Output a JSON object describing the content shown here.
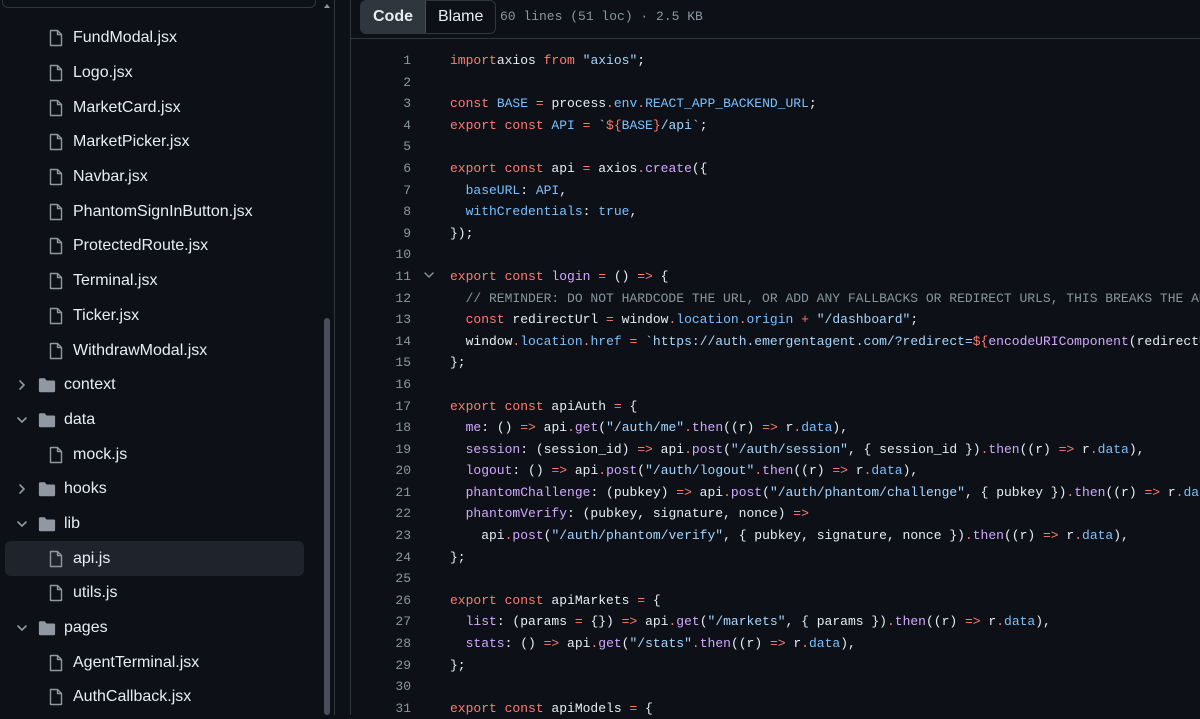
{
  "sidebar": {
    "tree": [
      {
        "type": "file",
        "label": "FundModal.jsx"
      },
      {
        "type": "file",
        "label": "Logo.jsx"
      },
      {
        "type": "file",
        "label": "MarketCard.jsx"
      },
      {
        "type": "file",
        "label": "MarketPicker.jsx"
      },
      {
        "type": "file",
        "label": "Navbar.jsx"
      },
      {
        "type": "file",
        "label": "PhantomSignInButton.jsx"
      },
      {
        "type": "file",
        "label": "ProtectedRoute.jsx"
      },
      {
        "type": "file",
        "label": "Terminal.jsx"
      },
      {
        "type": "file",
        "label": "Ticker.jsx"
      },
      {
        "type": "file",
        "label": "WithdrawModal.jsx"
      },
      {
        "type": "folder",
        "label": "context",
        "expanded": false
      },
      {
        "type": "folder",
        "label": "data",
        "expanded": true
      },
      {
        "type": "file",
        "label": "mock.js"
      },
      {
        "type": "folder",
        "label": "hooks",
        "expanded": false
      },
      {
        "type": "folder",
        "label": "lib",
        "expanded": true
      },
      {
        "type": "file",
        "label": "api.js",
        "selected": true
      },
      {
        "type": "file",
        "label": "utils.js"
      },
      {
        "type": "folder",
        "label": "pages",
        "expanded": true
      },
      {
        "type": "file",
        "label": "AgentTerminal.jsx"
      },
      {
        "type": "file",
        "label": "AuthCallback.jsx"
      }
    ]
  },
  "toolbar": {
    "code_label": "Code",
    "blame_label": "Blame",
    "file_info": "60 lines (51 loc) · 2.5 KB"
  },
  "code": {
    "lines": [
      {
        "n": "1",
        "fold": false,
        "tokens": [
          [
            "kw",
            "import"
          ],
          [
            "",
            "axios"
          ],
          [
            "kw",
            " from "
          ],
          [
            "str",
            "\"axios\""
          ],
          [
            "",
            ";"
          ]
        ]
      },
      {
        "n": "2",
        "fold": false,
        "tokens": []
      },
      {
        "n": "3",
        "fold": false,
        "tokens": [
          [
            "kw",
            "const "
          ],
          [
            "prop",
            "BASE"
          ],
          [
            "kw",
            " = "
          ],
          [
            "",
            "process"
          ],
          [
            "kw",
            "."
          ],
          [
            "prop",
            "env"
          ],
          [
            "kw",
            "."
          ],
          [
            "prop",
            "REACT_APP_BACKEND_URL"
          ],
          [
            "",
            ";"
          ]
        ]
      },
      {
        "n": "4",
        "fold": false,
        "tokens": [
          [
            "kw",
            "export const "
          ],
          [
            "prop",
            "API"
          ],
          [
            "kw",
            " = "
          ],
          [
            "str",
            "`"
          ],
          [
            "kw",
            "${"
          ],
          [
            "prop",
            "BASE"
          ],
          [
            "kw",
            "}"
          ],
          [
            "str",
            "/api`"
          ],
          [
            "",
            ";"
          ]
        ]
      },
      {
        "n": "5",
        "fold": false,
        "tokens": []
      },
      {
        "n": "6",
        "fold": false,
        "tokens": [
          [
            "kw",
            "export const "
          ],
          [
            "",
            "api"
          ],
          [
            "kw",
            " = "
          ],
          [
            "",
            "axios"
          ],
          [
            "kw",
            "."
          ],
          [
            "fn",
            "create"
          ],
          [
            "",
            "({"
          ]
        ]
      },
      {
        "n": "7",
        "fold": false,
        "tokens": [
          [
            "prop",
            "  baseURL"
          ],
          [
            "",
            ": "
          ],
          [
            "prop",
            "API"
          ],
          [
            "",
            ","
          ]
        ]
      },
      {
        "n": "8",
        "fold": false,
        "tokens": [
          [
            "prop",
            "  withCredentials"
          ],
          [
            "",
            ": "
          ],
          [
            "prop",
            "true"
          ],
          [
            "",
            ","
          ]
        ]
      },
      {
        "n": "9",
        "fold": false,
        "tokens": [
          [
            "",
            "});"
          ]
        ]
      },
      {
        "n": "10",
        "fold": false,
        "tokens": []
      },
      {
        "n": "11",
        "fold": true,
        "tokens": [
          [
            "kw",
            "export const "
          ],
          [
            "fn",
            "login"
          ],
          [
            "kw",
            " = "
          ],
          [
            "",
            "() "
          ],
          [
            "kw",
            "=>"
          ],
          [
            "",
            " {"
          ]
        ]
      },
      {
        "n": "12",
        "fold": false,
        "tokens": [
          [
            "cmt",
            "  // REMINDER: DO NOT HARDCODE THE URL, OR ADD ANY FALLBACKS OR REDIRECT URLS, THIS BREAKS THE AUTH"
          ]
        ]
      },
      {
        "n": "13",
        "fold": false,
        "tokens": [
          [
            "kw",
            "  const "
          ],
          [
            "",
            "redirectUrl"
          ],
          [
            "kw",
            " = "
          ],
          [
            "",
            "window"
          ],
          [
            "kw",
            "."
          ],
          [
            "prop",
            "location"
          ],
          [
            "kw",
            "."
          ],
          [
            "prop",
            "origin"
          ],
          [
            "kw",
            " + "
          ],
          [
            "str",
            "\"/dashboard\""
          ],
          [
            "",
            ";"
          ]
        ]
      },
      {
        "n": "14",
        "fold": false,
        "tokens": [
          [
            "",
            "  window"
          ],
          [
            "kw",
            "."
          ],
          [
            "prop",
            "location"
          ],
          [
            "kw",
            "."
          ],
          [
            "prop",
            "href"
          ],
          [
            "kw",
            " = "
          ],
          [
            "str",
            "`https://auth.emergentagent.com/?redirect="
          ],
          [
            "kw",
            "${"
          ],
          [
            "fn",
            "encodeURIComponent"
          ],
          [
            "",
            "(redirectUrl)"
          ],
          [
            "kw",
            "}"
          ],
          [
            "str",
            "`"
          ],
          [
            "",
            ";"
          ]
        ]
      },
      {
        "n": "15",
        "fold": false,
        "tokens": [
          [
            "",
            "};"
          ]
        ]
      },
      {
        "n": "16",
        "fold": false,
        "tokens": []
      },
      {
        "n": "17",
        "fold": false,
        "tokens": [
          [
            "kw",
            "export const "
          ],
          [
            "",
            "apiAuth"
          ],
          [
            "kw",
            " = "
          ],
          [
            "",
            "{"
          ]
        ]
      },
      {
        "n": "18",
        "fold": false,
        "tokens": [
          [
            "fn",
            "  me"
          ],
          [
            "",
            ": () "
          ],
          [
            "kw",
            "=>"
          ],
          [
            "",
            " api"
          ],
          [
            "kw",
            "."
          ],
          [
            "fn",
            "get"
          ],
          [
            "",
            "("
          ],
          [
            "str",
            "\"/auth/me\""
          ],
          [
            ")"
          ],
          [
            "kw",
            "."
          ],
          [
            "fn",
            "then"
          ],
          [
            "",
            "((r) "
          ],
          [
            "kw",
            "=>"
          ],
          [
            "",
            " r"
          ],
          [
            "kw",
            "."
          ],
          [
            "prop",
            "data"
          ],
          [
            "",
            "),"
          ]
        ]
      },
      {
        "n": "19",
        "fold": false,
        "tokens": [
          [
            "fn",
            "  session"
          ],
          [
            "",
            ": (session_id) "
          ],
          [
            "kw",
            "=>"
          ],
          [
            "",
            " api"
          ],
          [
            "kw",
            "."
          ],
          [
            "fn",
            "post"
          ],
          [
            "",
            "("
          ],
          [
            "str",
            "\"/auth/session\""
          ],
          [
            "",
            ", { session_id })"
          ],
          [
            "kw",
            "."
          ],
          [
            "fn",
            "then"
          ],
          [
            "",
            "((r) "
          ],
          [
            "kw",
            "=>"
          ],
          [
            "",
            " r"
          ],
          [
            "kw",
            "."
          ],
          [
            "prop",
            "data"
          ],
          [
            "",
            "),"
          ]
        ]
      },
      {
        "n": "20",
        "fold": false,
        "tokens": [
          [
            "fn",
            "  logout"
          ],
          [
            "",
            ": () "
          ],
          [
            "kw",
            "=>"
          ],
          [
            "",
            " api"
          ],
          [
            "kw",
            "."
          ],
          [
            "fn",
            "post"
          ],
          [
            "",
            "("
          ],
          [
            "str",
            "\"/auth/logout\""
          ],
          [
            ")"
          ],
          [
            "kw",
            "."
          ],
          [
            "fn",
            "then"
          ],
          [
            "",
            "((r) "
          ],
          [
            "kw",
            "=>"
          ],
          [
            "",
            " r"
          ],
          [
            "kw",
            "."
          ],
          [
            "prop",
            "data"
          ],
          [
            "",
            "),"
          ]
        ]
      },
      {
        "n": "21",
        "fold": false,
        "tokens": [
          [
            "fn",
            "  phantomChallenge"
          ],
          [
            "",
            ": (pubkey) "
          ],
          [
            "kw",
            "=>"
          ],
          [
            "",
            " api"
          ],
          [
            "kw",
            "."
          ],
          [
            "fn",
            "post"
          ],
          [
            "",
            "("
          ],
          [
            "str",
            "\"/auth/phantom/challenge\""
          ],
          [
            "",
            ", { pubkey })"
          ],
          [
            "kw",
            "."
          ],
          [
            "fn",
            "then"
          ],
          [
            "",
            "((r) "
          ],
          [
            "kw",
            "=>"
          ],
          [
            "",
            " r"
          ],
          [
            "kw",
            "."
          ],
          [
            "prop",
            "data"
          ],
          [
            "",
            "),"
          ]
        ]
      },
      {
        "n": "22",
        "fold": false,
        "tokens": [
          [
            "fn",
            "  phantomVerify"
          ],
          [
            "",
            ": (pubkey, signature, nonce) "
          ],
          [
            "kw",
            "=>"
          ]
        ]
      },
      {
        "n": "23",
        "fold": false,
        "tokens": [
          [
            "",
            "    api"
          ],
          [
            "kw",
            "."
          ],
          [
            "fn",
            "post"
          ],
          [
            "",
            "("
          ],
          [
            "str",
            "\"/auth/phantom/verify\""
          ],
          [
            "",
            ", { pubkey, signature, nonce })"
          ],
          [
            "kw",
            "."
          ],
          [
            "fn",
            "then"
          ],
          [
            "",
            "((r) "
          ],
          [
            "kw",
            "=>"
          ],
          [
            "",
            " r"
          ],
          [
            "kw",
            "."
          ],
          [
            "prop",
            "data"
          ],
          [
            "",
            "),"
          ]
        ]
      },
      {
        "n": "24",
        "fold": false,
        "tokens": [
          [
            "",
            "};"
          ]
        ]
      },
      {
        "n": "25",
        "fold": false,
        "tokens": []
      },
      {
        "n": "26",
        "fold": false,
        "tokens": [
          [
            "kw",
            "export const "
          ],
          [
            "",
            "apiMarkets"
          ],
          [
            "kw",
            " = "
          ],
          [
            "",
            "{"
          ]
        ]
      },
      {
        "n": "27",
        "fold": false,
        "tokens": [
          [
            "fn",
            "  list"
          ],
          [
            "",
            ": (params "
          ],
          [
            "kw",
            "="
          ],
          [
            "",
            " {}) "
          ],
          [
            "kw",
            "=>"
          ],
          [
            "",
            " api"
          ],
          [
            "kw",
            "."
          ],
          [
            "fn",
            "get"
          ],
          [
            "",
            "("
          ],
          [
            "str",
            "\"/markets\""
          ],
          [
            "",
            ", { params })"
          ],
          [
            "kw",
            "."
          ],
          [
            "fn",
            "then"
          ],
          [
            "",
            "((r) "
          ],
          [
            "kw",
            "=>"
          ],
          [
            "",
            " r"
          ],
          [
            "kw",
            "."
          ],
          [
            "prop",
            "data"
          ],
          [
            "",
            "),"
          ]
        ]
      },
      {
        "n": "28",
        "fold": false,
        "tokens": [
          [
            "fn",
            "  stats"
          ],
          [
            "",
            ": () "
          ],
          [
            "kw",
            "=>"
          ],
          [
            "",
            " api"
          ],
          [
            "kw",
            "."
          ],
          [
            "fn",
            "get"
          ],
          [
            "",
            "("
          ],
          [
            "str",
            "\"/stats\""
          ],
          [
            ")"
          ],
          [
            "kw",
            "."
          ],
          [
            "fn",
            "then"
          ],
          [
            "",
            "((r) "
          ],
          [
            "kw",
            "=>"
          ],
          [
            "",
            " r"
          ],
          [
            "kw",
            "."
          ],
          [
            "prop",
            "data"
          ],
          [
            "",
            "),"
          ]
        ]
      },
      {
        "n": "29",
        "fold": false,
        "tokens": [
          [
            "",
            "};"
          ]
        ]
      },
      {
        "n": "30",
        "fold": false,
        "tokens": []
      },
      {
        "n": "31",
        "fold": false,
        "tokens": [
          [
            "kw",
            "export const "
          ],
          [
            "",
            "apiModels"
          ],
          [
            "kw",
            " = "
          ],
          [
            "",
            "{"
          ]
        ]
      }
    ]
  }
}
